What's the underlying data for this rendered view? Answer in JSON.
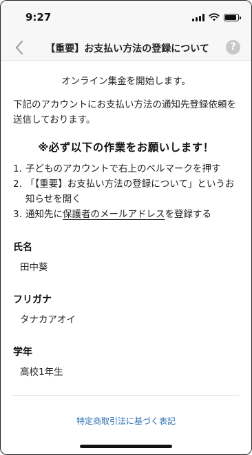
{
  "status_bar": {
    "time": "9:27"
  },
  "nav": {
    "title": "【重要】お支払い方法の登録について",
    "help_label": "?"
  },
  "intro": "オンライン集金を開始します。",
  "notice": "下記のアカウントにお支払い方法の通知先登録依頼を送信しております。",
  "heading": "※必ず以下の作業をお願いします！",
  "steps": [
    {
      "num": "1.",
      "text": "子どものアカウントで右上のベルマークを押す"
    },
    {
      "num": "2.",
      "text": "「【重要】お支払い方法の登録について」というお知らせを開く"
    },
    {
      "num": "3.",
      "prefix": "通知先に",
      "underlined": "保護者のメールアドレス",
      "suffix": "を登録する"
    }
  ],
  "fields": [
    {
      "label": "氏名",
      "value": "田中葵"
    },
    {
      "label": "フリガナ",
      "value": "タナカアオイ"
    },
    {
      "label": "学年",
      "value": "高校1年生"
    }
  ],
  "footer_link": "特定商取引法に基づく表記",
  "colors": {
    "link": "#2b6fb3",
    "help_bg": "#c8c8c8",
    "bar_bg": "#f7f7f7",
    "back_chevron": "#9aa3aa"
  },
  "icons": {
    "back": "chevron-left-icon",
    "help": "question-circle-icon",
    "wifi": "wifi-icon",
    "battery": "battery-icon",
    "signal": "cellular-signal-icon"
  }
}
